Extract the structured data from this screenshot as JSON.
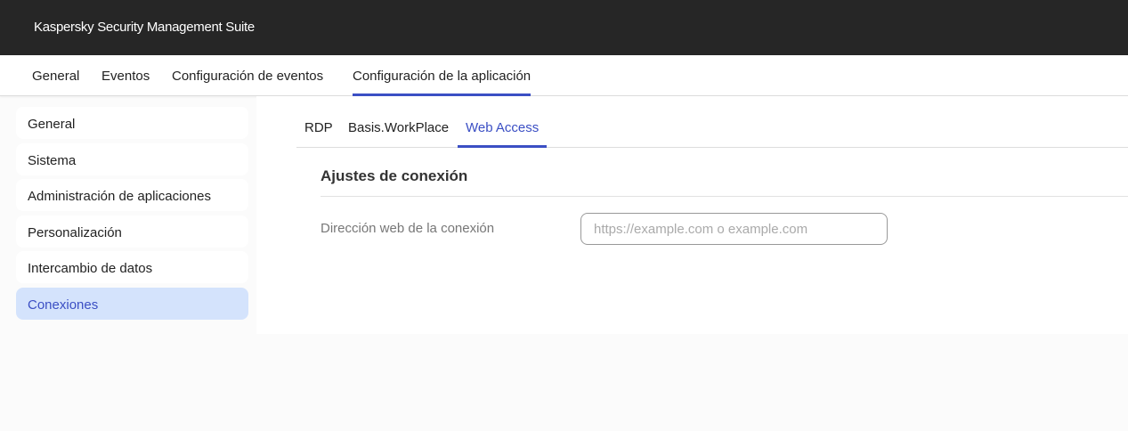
{
  "header": {
    "title": "Kaspersky Security Management Suite"
  },
  "topnav": {
    "items": [
      {
        "label": "General"
      },
      {
        "label": "Eventos"
      },
      {
        "label": "Configuración de eventos"
      },
      {
        "label": "Configuración de la aplicación"
      }
    ],
    "active": 3
  },
  "sidebar": {
    "items": [
      {
        "label": "General"
      },
      {
        "label": "Sistema"
      },
      {
        "label": "Administración de aplicaciones"
      },
      {
        "label": "Personalización"
      },
      {
        "label": "Intercambio de datos"
      },
      {
        "label": "Conexiones"
      }
    ],
    "active": 5
  },
  "tabs": {
    "items": [
      {
        "label": "RDP"
      },
      {
        "label": "Basis.WorkPlace"
      },
      {
        "label": "Web Access"
      }
    ],
    "active": 2
  },
  "section": {
    "title": "Ajustes de conexión",
    "field_label": "Dirección web de la conexión",
    "field_value": "",
    "field_placeholder": "https://example.com o example.com"
  },
  "colors": {
    "accent": "#3b4fc4",
    "header_bg": "#262626",
    "selected_bg": "#d4e3fc"
  }
}
